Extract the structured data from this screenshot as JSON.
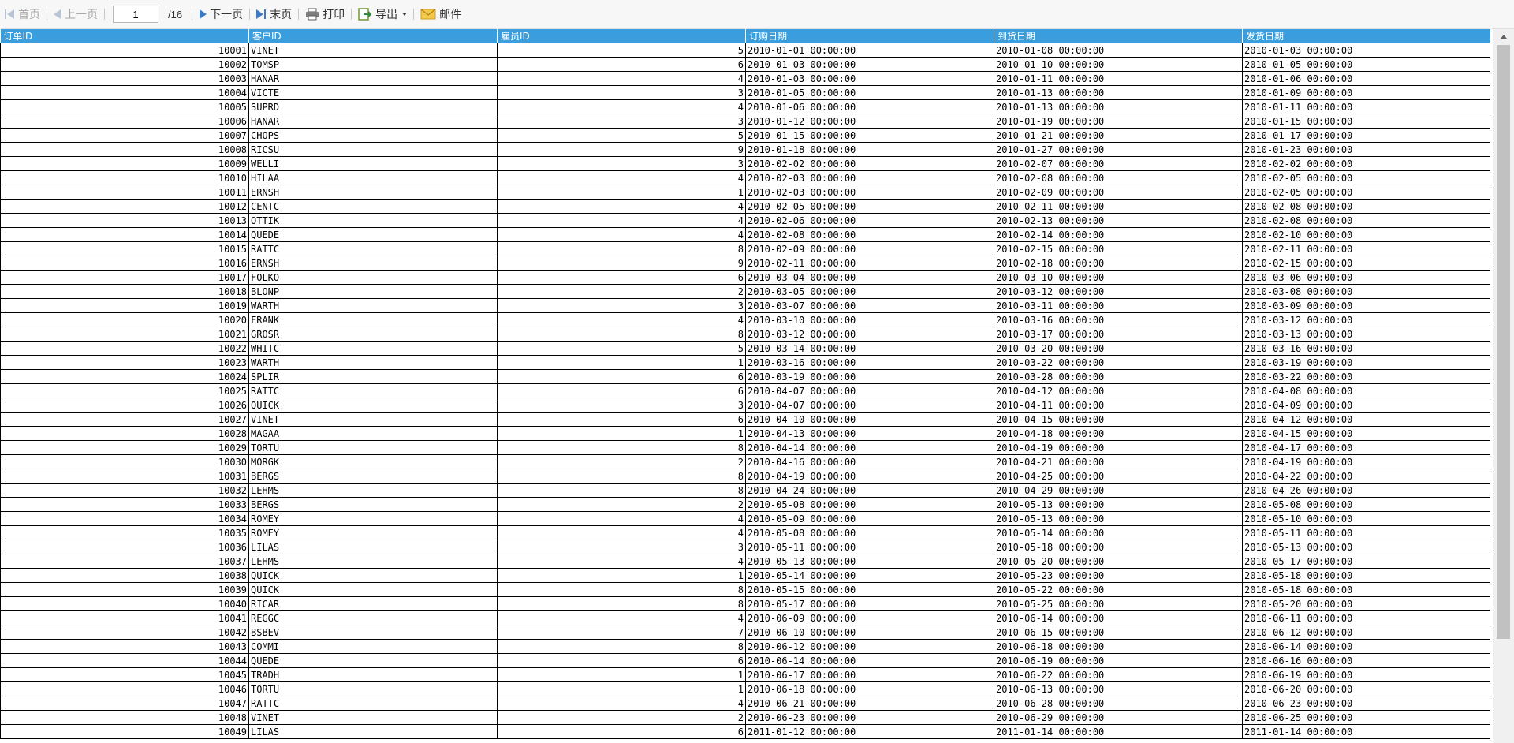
{
  "toolbar": {
    "first": "首页",
    "prev": "上一页",
    "page_value": "1",
    "total": "/16",
    "next": "下一页",
    "last": "末页",
    "print": "打印",
    "export": "导出",
    "mail": "邮件"
  },
  "columns": [
    "订单ID",
    "客户ID",
    "雇员ID",
    "订购日期",
    "到货日期",
    "发货日期"
  ],
  "rows": [
    [
      "10001",
      "VINET",
      "5",
      "2010-01-01 00:00:00",
      "2010-01-08 00:00:00",
      "2010-01-03 00:00:00"
    ],
    [
      "10002",
      "TOMSP",
      "6",
      "2010-01-03 00:00:00",
      "2010-01-10 00:00:00",
      "2010-01-05 00:00:00"
    ],
    [
      "10003",
      "HANAR",
      "4",
      "2010-01-03 00:00:00",
      "2010-01-11 00:00:00",
      "2010-01-06 00:00:00"
    ],
    [
      "10004",
      "VICTE",
      "3",
      "2010-01-05 00:00:00",
      "2010-01-13 00:00:00",
      "2010-01-09 00:00:00"
    ],
    [
      "10005",
      "SUPRD",
      "4",
      "2010-01-06 00:00:00",
      "2010-01-13 00:00:00",
      "2010-01-11 00:00:00"
    ],
    [
      "10006",
      "HANAR",
      "3",
      "2010-01-12 00:00:00",
      "2010-01-19 00:00:00",
      "2010-01-15 00:00:00"
    ],
    [
      "10007",
      "CHOPS",
      "5",
      "2010-01-15 00:00:00",
      "2010-01-21 00:00:00",
      "2010-01-17 00:00:00"
    ],
    [
      "10008",
      "RICSU",
      "9",
      "2010-01-18 00:00:00",
      "2010-01-27 00:00:00",
      "2010-01-23 00:00:00"
    ],
    [
      "10009",
      "WELLI",
      "3",
      "2010-02-02 00:00:00",
      "2010-02-07 00:00:00",
      "2010-02-02 00:00:00"
    ],
    [
      "10010",
      "HILAA",
      "4",
      "2010-02-03 00:00:00",
      "2010-02-08 00:00:00",
      "2010-02-05 00:00:00"
    ],
    [
      "10011",
      "ERNSH",
      "1",
      "2010-02-03 00:00:00",
      "2010-02-09 00:00:00",
      "2010-02-05 00:00:00"
    ],
    [
      "10012",
      "CENTC",
      "4",
      "2010-02-05 00:00:00",
      "2010-02-11 00:00:00",
      "2010-02-08 00:00:00"
    ],
    [
      "10013",
      "OTTIK",
      "4",
      "2010-02-06 00:00:00",
      "2010-02-13 00:00:00",
      "2010-02-08 00:00:00"
    ],
    [
      "10014",
      "QUEDE",
      "4",
      "2010-02-08 00:00:00",
      "2010-02-14 00:00:00",
      "2010-02-10 00:00:00"
    ],
    [
      "10015",
      "RATTC",
      "8",
      "2010-02-09 00:00:00",
      "2010-02-15 00:00:00",
      "2010-02-11 00:00:00"
    ],
    [
      "10016",
      "ERNSH",
      "9",
      "2010-02-11 00:00:00",
      "2010-02-18 00:00:00",
      "2010-02-15 00:00:00"
    ],
    [
      "10017",
      "FOLKO",
      "6",
      "2010-03-04 00:00:00",
      "2010-03-10 00:00:00",
      "2010-03-06 00:00:00"
    ],
    [
      "10018",
      "BLONP",
      "2",
      "2010-03-05 00:00:00",
      "2010-03-12 00:00:00",
      "2010-03-08 00:00:00"
    ],
    [
      "10019",
      "WARTH",
      "3",
      "2010-03-07 00:00:00",
      "2010-03-11 00:00:00",
      "2010-03-09 00:00:00"
    ],
    [
      "10020",
      "FRANK",
      "4",
      "2010-03-10 00:00:00",
      "2010-03-16 00:00:00",
      "2010-03-12 00:00:00"
    ],
    [
      "10021",
      "GROSR",
      "8",
      "2010-03-12 00:00:00",
      "2010-03-17 00:00:00",
      "2010-03-13 00:00:00"
    ],
    [
      "10022",
      "WHITC",
      "5",
      "2010-03-14 00:00:00",
      "2010-03-20 00:00:00",
      "2010-03-16 00:00:00"
    ],
    [
      "10023",
      "WARTH",
      "1",
      "2010-03-16 00:00:00",
      "2010-03-22 00:00:00",
      "2010-03-19 00:00:00"
    ],
    [
      "10024",
      "SPLIR",
      "6",
      "2010-03-19 00:00:00",
      "2010-03-28 00:00:00",
      "2010-03-22 00:00:00"
    ],
    [
      "10025",
      "RATTC",
      "6",
      "2010-04-07 00:00:00",
      "2010-04-12 00:00:00",
      "2010-04-08 00:00:00"
    ],
    [
      "10026",
      "QUICK",
      "3",
      "2010-04-07 00:00:00",
      "2010-04-11 00:00:00",
      "2010-04-09 00:00:00"
    ],
    [
      "10027",
      "VINET",
      "6",
      "2010-04-10 00:00:00",
      "2010-04-15 00:00:00",
      "2010-04-12 00:00:00"
    ],
    [
      "10028",
      "MAGAA",
      "1",
      "2010-04-13 00:00:00",
      "2010-04-18 00:00:00",
      "2010-04-15 00:00:00"
    ],
    [
      "10029",
      "TORTU",
      "8",
      "2010-04-14 00:00:00",
      "2010-04-19 00:00:00",
      "2010-04-17 00:00:00"
    ],
    [
      "10030",
      "MORGK",
      "2",
      "2010-04-16 00:00:00",
      "2010-04-21 00:00:00",
      "2010-04-19 00:00:00"
    ],
    [
      "10031",
      "BERGS",
      "8",
      "2010-04-19 00:00:00",
      "2010-04-25 00:00:00",
      "2010-04-22 00:00:00"
    ],
    [
      "10032",
      "LEHMS",
      "8",
      "2010-04-24 00:00:00",
      "2010-04-29 00:00:00",
      "2010-04-26 00:00:00"
    ],
    [
      "10033",
      "BERGS",
      "2",
      "2010-05-08 00:00:00",
      "2010-05-13 00:00:00",
      "2010-05-08 00:00:00"
    ],
    [
      "10034",
      "ROMEY",
      "4",
      "2010-05-09 00:00:00",
      "2010-05-13 00:00:00",
      "2010-05-10 00:00:00"
    ],
    [
      "10035",
      "ROMEY",
      "4",
      "2010-05-08 00:00:00",
      "2010-05-14 00:00:00",
      "2010-05-11 00:00:00"
    ],
    [
      "10036",
      "LILAS",
      "3",
      "2010-05-11 00:00:00",
      "2010-05-18 00:00:00",
      "2010-05-13 00:00:00"
    ],
    [
      "10037",
      "LEHMS",
      "4",
      "2010-05-13 00:00:00",
      "2010-05-20 00:00:00",
      "2010-05-17 00:00:00"
    ],
    [
      "10038",
      "QUICK",
      "1",
      "2010-05-14 00:00:00",
      "2010-05-23 00:00:00",
      "2010-05-18 00:00:00"
    ],
    [
      "10039",
      "QUICK",
      "8",
      "2010-05-15 00:00:00",
      "2010-05-22 00:00:00",
      "2010-05-18 00:00:00"
    ],
    [
      "10040",
      "RICAR",
      "8",
      "2010-05-17 00:00:00",
      "2010-05-25 00:00:00",
      "2010-05-20 00:00:00"
    ],
    [
      "10041",
      "REGGC",
      "4",
      "2010-06-09 00:00:00",
      "2010-06-14 00:00:00",
      "2010-06-11 00:00:00"
    ],
    [
      "10042",
      "BSBEV",
      "7",
      "2010-06-10 00:00:00",
      "2010-06-15 00:00:00",
      "2010-06-12 00:00:00"
    ],
    [
      "10043",
      "COMMI",
      "8",
      "2010-06-12 00:00:00",
      "2010-06-18 00:00:00",
      "2010-06-14 00:00:00"
    ],
    [
      "10044",
      "QUEDE",
      "6",
      "2010-06-14 00:00:00",
      "2010-06-19 00:00:00",
      "2010-06-16 00:00:00"
    ],
    [
      "10045",
      "TRADH",
      "1",
      "2010-06-17 00:00:00",
      "2010-06-22 00:00:00",
      "2010-06-19 00:00:00"
    ],
    [
      "10046",
      "TORTU",
      "1",
      "2010-06-18 00:00:00",
      "2010-06-13 00:00:00",
      "2010-06-20 00:00:00"
    ],
    [
      "10047",
      "RATTC",
      "4",
      "2010-06-21 00:00:00",
      "2010-06-28 00:00:00",
      "2010-06-23 00:00:00"
    ],
    [
      "10048",
      "VINET",
      "2",
      "2010-06-23 00:00:00",
      "2010-06-29 00:00:00",
      "2010-06-25 00:00:00"
    ],
    [
      "10049",
      "LILAS",
      "6",
      "2011-01-12 00:00:00",
      "2011-01-14 00:00:00",
      "2011-01-14 00:00:00"
    ]
  ],
  "colors": {
    "header_bg": "#3a9ede",
    "header_text": "#ffffff",
    "link_blue": "#3a7bc8",
    "disabled": "#b7c6d6"
  },
  "icons": [
    "first-page-icon",
    "prev-page-icon",
    "next-page-icon",
    "last-page-icon",
    "print-icon",
    "export-icon",
    "mail-icon"
  ]
}
